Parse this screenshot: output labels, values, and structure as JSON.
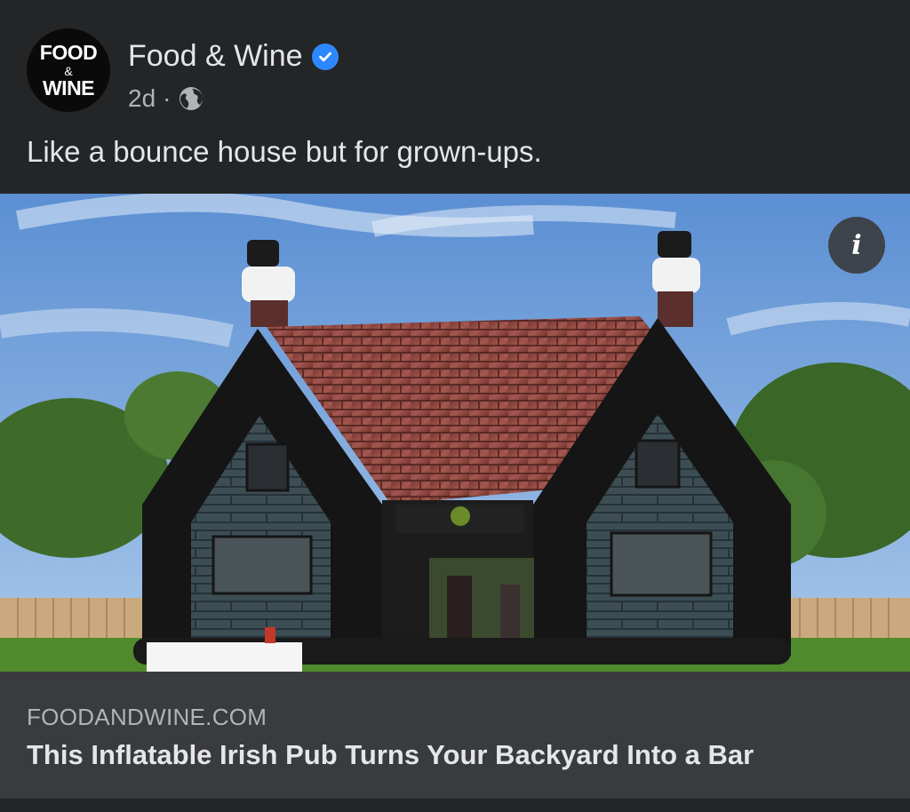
{
  "post": {
    "page_name": "Food & Wine",
    "avatar": {
      "line1": "FOOD",
      "amp": "&",
      "line2": "WINE"
    },
    "time": "2d",
    "separator": "·",
    "caption": "Like a bounce house but for grown-ups.",
    "verified_icon": "verified-badge-icon",
    "audience_icon": "globe-icon"
  },
  "media": {
    "image_alt": "Inflatable Irish pub in a backyard",
    "info_icon": "info-icon",
    "info_label": "i"
  },
  "link": {
    "domain": "FOODANDWINE.COM",
    "title": "This Inflatable Irish Pub Turns Your Backyard Into a Bar"
  },
  "colors": {
    "background": "#242526",
    "card": "#3a3b3c",
    "text_primary": "#e4e6eb",
    "text_secondary": "#b0b3b8",
    "verified": "#2d88ff"
  }
}
